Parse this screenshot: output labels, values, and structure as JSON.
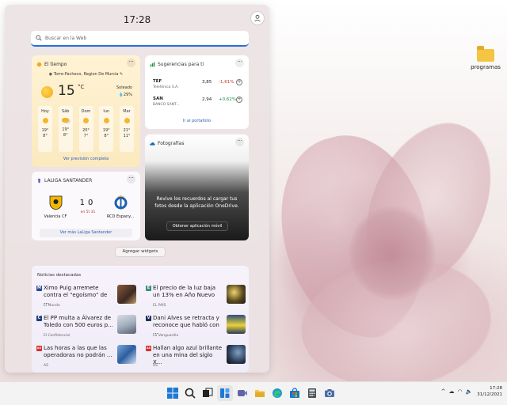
{
  "desktop": {
    "folder_label": "programas"
  },
  "panel": {
    "time": "17:28",
    "search_placeholder": "Buscar en la Web"
  },
  "weather": {
    "title": "El tiempo",
    "location": "Torre-Pacheco, Region De Murcia",
    "temp": "15",
    "unit": "°C",
    "condition": "Soleado",
    "rain": "29%",
    "days": [
      {
        "name": "Hoy",
        "hi": "19°",
        "lo": "8°"
      },
      {
        "name": "Sáb",
        "hi": "19°",
        "lo": "8°"
      },
      {
        "name": "Dom",
        "hi": "20°",
        "lo": "7°"
      },
      {
        "name": "lun",
        "hi": "19°",
        "lo": "8°"
      },
      {
        "name": "Mar",
        "hi": "21°",
        "lo": "11°"
      }
    ],
    "link": "Ver previsión completa"
  },
  "stocks": {
    "title": "Sugerencias para ti",
    "rows": [
      {
        "ticker": "TEF",
        "company": "Telefónica S.A.",
        "price": "3,85",
        "change": "-1,61%",
        "color": "#c0392b"
      },
      {
        "ticker": "SAN",
        "company": "BANCO SANT...",
        "price": "2,94",
        "change": "+0,62%",
        "color": "#1e8e3e"
      }
    ],
    "link": "Ir al portafolio"
  },
  "photos": {
    "title": "Fotografías",
    "message": "Revive los recuerdos al cargar tus fotos desde la aplicación OneDrive.",
    "button": "Obtener aplicación móvil"
  },
  "laliga": {
    "title": "LALIGA SANTANDER",
    "team1": "Valencia CF",
    "team2": "RCD Espany...",
    "score1": "1",
    "score2": "0",
    "status": "en 5t 31",
    "link": "Ver más LaLiga Santander"
  },
  "add_widgets": "Agregar widgets",
  "news": {
    "title": "Noticias destacadas",
    "items": [
      {
        "headline": "Ximo Puig arremete contra el \"egoísmo\" de ...",
        "source": "El Mundo",
        "badge": "M",
        "badge_color": "#2b4a8f"
      },
      {
        "headline": "El precio de la luz baja un 13% en Año Nuevo",
        "source": "EL PAÍS",
        "badge": "E",
        "badge_color": "#3d8f84"
      },
      {
        "headline": "El PP multa a Álvarez de Toledo con 500 euros p...",
        "source": "El Confidencial",
        "badge": "C",
        "badge_color": "#1e3f7a"
      },
      {
        "headline": "Dani Alves se retracta y reconoce que habló con ...",
        "source": "La Vanguardia",
        "badge": "V",
        "badge_color": "#1d2f5e"
      },
      {
        "headline": "Las horas a las que las operadoras no podrán ...",
        "source": "AS",
        "badge": "AS",
        "badge_color": "#d4322c"
      },
      {
        "headline": "Hallan algo azul brillante en una mina del siglo X...",
        "source": "AS",
        "badge": "AS",
        "badge_color": "#d4322c"
      }
    ]
  },
  "taskbar": {
    "time": "17:28",
    "date": "31/12/2021",
    "tray_caret": "^"
  }
}
